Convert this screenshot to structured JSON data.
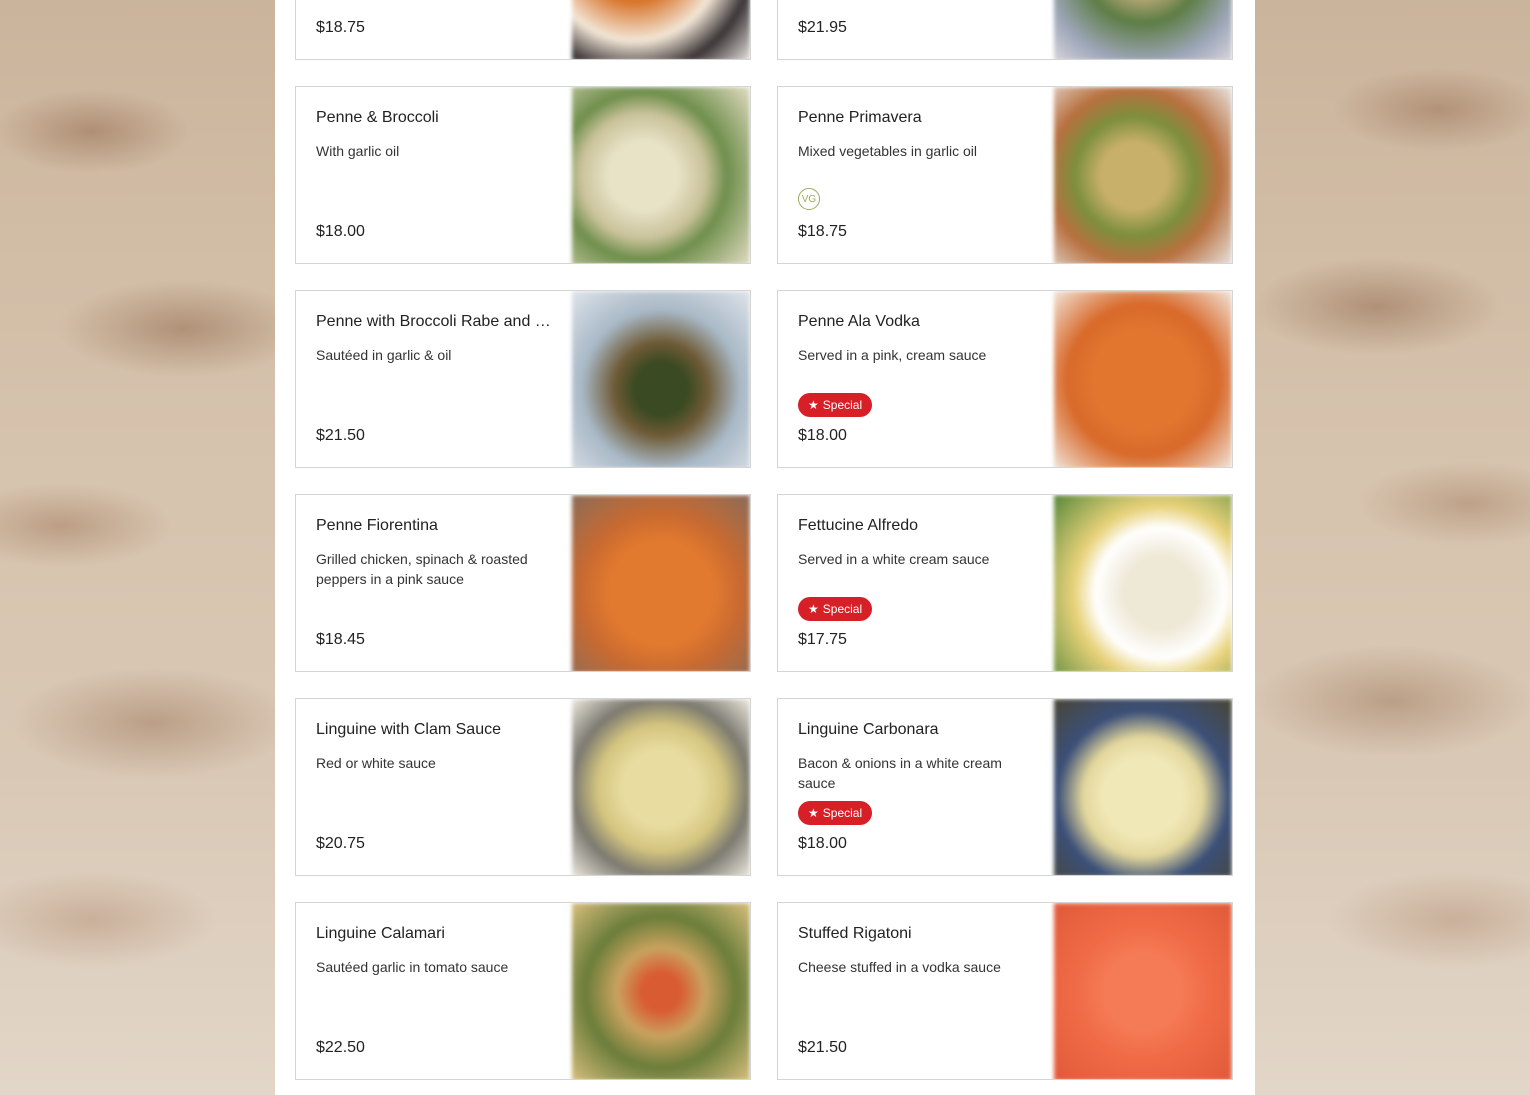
{
  "menu": {
    "items": [
      {
        "name": "",
        "description": "",
        "price": "$18.75",
        "tag": "",
        "photo": "radial-gradient(circle at 35% 40%, #d8742a 0 30%, #f2e6d6 55%, #3b3537 75%, #e9e4df 100%)"
      },
      {
        "name": "",
        "description": "",
        "price": "$21.95",
        "tag": "",
        "photo": "radial-gradient(circle at 50% 45%, #b9a877 0 25%, #5d7d45 45%, #9da6b8 75%, #d8d5db 100%)"
      },
      {
        "name": "Penne & Broccoli",
        "description": "With garlic oil",
        "price": "$18.00",
        "tag": "",
        "photo": "radial-gradient(circle at 40% 50%, #e8e2c7 0 25%, #c9c29a 45%, #6f8f4c 60%, #e3dcc3 100%)"
      },
      {
        "name": "Penne Primavera",
        "description": "Mixed vegetables in garlic oil",
        "price": "$18.75",
        "tag": "vg",
        "tag_label": "VG",
        "photo": "radial-gradient(circle at 45% 50%, #c9b06a 0 25%, #7c8f3c 45%, #b8703f 65%, #e8e4e0 100%)"
      },
      {
        "name": "Penne with Broccoli Rabe and Sausage",
        "description": "Sautéed in garlic & oil",
        "price": "$21.50",
        "tag": "",
        "photo": "radial-gradient(circle at 50% 55%, #3a4a22 0 20%, #6e5a35 35%, #a9b9c7 60%, #dfe4ea 100%)"
      },
      {
        "name": "Penne Ala Vodka",
        "description": "Served in a pink, cream sauce",
        "price": "$18.00",
        "tag": "special",
        "tag_label": "Special",
        "photo": "radial-gradient(circle at 50% 50%, #e2762f 0 40%, #d8692a 60%, #f1e6db 100%)"
      },
      {
        "name": "Penne Fiorentina",
        "description": "Grilled chicken, spinach & roasted peppers in a pink sauce",
        "price": "$18.45",
        "tag": "",
        "photo": "radial-gradient(circle at 50% 55%, #e1792f 0 40%, #c86a31 60%, #8a6c5a 100%)"
      },
      {
        "name": "Fettucine Alfredo",
        "description": "Served in a white cream sauce",
        "price": "$17.75",
        "tag": "special",
        "tag_label": "Special",
        "photo": "radial-gradient(circle at 60% 55%, #eee8d6 0 25%, #ffffff 45%, #e8d27a 60%, #57883a 100%)"
      },
      {
        "name": "Linguine with Clam Sauce",
        "description": "Red or white sauce",
        "price": "$20.75",
        "tag": "",
        "photo": "radial-gradient(circle at 50% 50%, #e8dca0 0 30%, #d4c57f 50%, #7c7a70 70%, #eeeae0 100%)"
      },
      {
        "name": "Linguine Carbonara",
        "description": "Bacon & onions in a white cream sauce",
        "price": "$18.00",
        "tag": "special",
        "tag_label": "Special",
        "photo": "radial-gradient(circle at 50% 55%, #f1e8b8 0 30%, #e3d79c 45%, #3b4f78 65%, #4a4634 100%)"
      },
      {
        "name": "Linguine Calamari",
        "description": "Sautéed garlic in tomato sauce",
        "price": "$22.50",
        "tag": "",
        "photo": "radial-gradient(circle at 50% 50%, #d95b31 0 15%, #c9a25f 35%, #6b7d3a 60%, #d9bf7d 100%)"
      },
      {
        "name": "Stuffed Rigatoni",
        "description": "Cheese stuffed in a vodka sauce",
        "price": "$21.50",
        "tag": "",
        "photo": "radial-gradient(circle at 50% 50%, #f57b56 0 30%, #ef6a45 55%, #e05a3a 100%)"
      }
    ]
  }
}
